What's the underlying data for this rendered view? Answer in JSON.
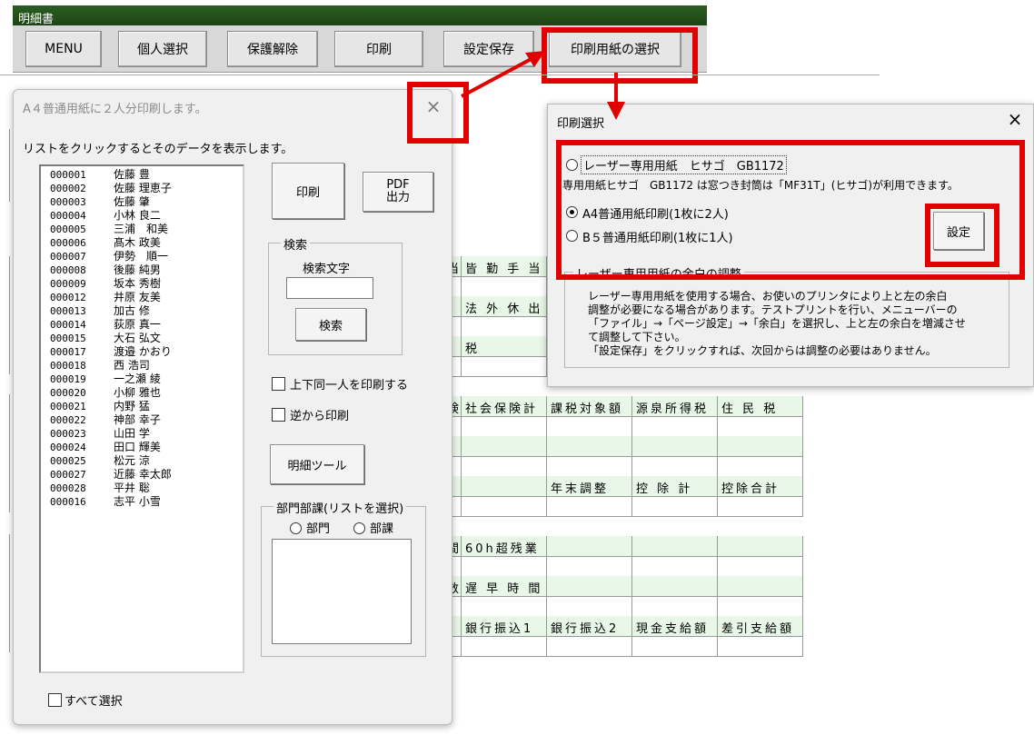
{
  "app": {
    "title": "明細書"
  },
  "toolbar": {
    "menu": "MENU",
    "individual": "個人選択",
    "unprotect": "保護解除",
    "print": "印刷",
    "save_settings": "設定保存",
    "paper_select": "印刷用紙の選択"
  },
  "sheet": {
    "rows": [
      [
        "当",
        "皆 勤 手 当",
        "",
        "",
        ""
      ],
      [
        "",
        "",
        "",
        "",
        ""
      ],
      [
        "",
        "法 外 休 出",
        "",
        "",
        ""
      ],
      [
        "",
        "",
        "",
        "",
        ""
      ],
      [
        "",
        "税",
        "",
        "",
        ""
      ],
      [
        "",
        "",
        "",
        "",
        ""
      ]
    ],
    "rows2": [
      [
        "険",
        "社会保険計",
        "課税対象額",
        "源泉所得税",
        "住 民 税"
      ],
      [
        "",
        "",
        "",
        "",
        ""
      ],
      [
        "",
        "",
        "",
        "",
        ""
      ],
      [
        "",
        "",
        "",
        "",
        ""
      ],
      [
        "",
        "",
        "年末調整",
        "控 除 計",
        "控除合計"
      ],
      [
        "",
        "",
        "",
        "",
        ""
      ]
    ],
    "rows3": [
      [
        "間",
        "60h超残業",
        "",
        "",
        ""
      ],
      [
        "",
        "",
        "",
        "",
        ""
      ],
      [
        "数",
        "遅 早 時 間",
        "",
        "",
        ""
      ],
      [
        "",
        "",
        "",
        "",
        ""
      ],
      [
        "",
        "銀行振込1",
        "銀行振込2",
        "現金支給額",
        "差引支給額"
      ],
      [
        "",
        "",
        "",
        "",
        ""
      ]
    ]
  },
  "dialog1": {
    "title": "A４普通用紙に２人分印刷します。",
    "close": "×",
    "instruction": "リストをクリックするとそのデータを表示します。",
    "employees": [
      {
        "id": "000001",
        "name": "佐藤 豊"
      },
      {
        "id": "000002",
        "name": "佐藤 理恵子"
      },
      {
        "id": "000003",
        "name": "佐藤 肇"
      },
      {
        "id": "000004",
        "name": "小林 良二"
      },
      {
        "id": "000005",
        "name": "三浦　和美"
      },
      {
        "id": "000006",
        "name": "髙木 政美"
      },
      {
        "id": "000007",
        "name": "伊勢　順一"
      },
      {
        "id": "000008",
        "name": "後藤 純男"
      },
      {
        "id": "000009",
        "name": "坂本 秀樹"
      },
      {
        "id": "000012",
        "name": "井原 友美"
      },
      {
        "id": "000013",
        "name": "加古 修"
      },
      {
        "id": "000014",
        "name": "荻原 真一"
      },
      {
        "id": "000015",
        "name": "大石 弘文"
      },
      {
        "id": "000017",
        "name": "渡邉 かおり"
      },
      {
        "id": "000018",
        "name": "西 浩司"
      },
      {
        "id": "000019",
        "name": "一之瀬 綾"
      },
      {
        "id": "000020",
        "name": "小柳 雅也"
      },
      {
        "id": "000021",
        "name": "内野 猛"
      },
      {
        "id": "000022",
        "name": "神部 幸子"
      },
      {
        "id": "000023",
        "name": "山田 学"
      },
      {
        "id": "000024",
        "name": "田口 輝美"
      },
      {
        "id": "000025",
        "name": "松元 涼"
      },
      {
        "id": "000027",
        "name": "近藤 幸太郎"
      },
      {
        "id": "000028",
        "name": "平井 聡"
      },
      {
        "id": "000016",
        "name": "志平 小雪"
      }
    ],
    "print_btn": "印刷",
    "pdf_line1": "PDF",
    "pdf_line2": "出力",
    "search_group": "検索",
    "search_label": "検索文字",
    "search_value": "",
    "search_btn": "検索",
    "same_person": "上下同一人を印刷する",
    "reverse_print": "逆から印刷",
    "tool_btn": "明細ツール",
    "dept_group": "部門部課(リストを選択)",
    "dept": "部門",
    "section": "部課",
    "select_all": "すべて選択"
  },
  "dialog2": {
    "title": "印刷選択",
    "close": "×",
    "opt_laser": "レーザー専用用紙　ヒサゴ　GB1172",
    "laser_note": "専用用紙ヒサゴ　GB1172 は窓つき封筒は「MF31T」(ヒサゴ)が利用できます。",
    "opt_a4": "A4普通用紙印刷(1枚に2人)",
    "opt_b5": "B５普通用紙印刷(1枚に1人)",
    "settings_btn": "設定",
    "margin_group": "レーザー専用用紙の余白の調整",
    "margin_text": [
      "レーザー専用用紙を使用する場合、お使いのプリンタにより上と左の余白",
      "調整が必要になる場合があります。テストプリントを行い、メニューバーの",
      "「ファイル」→「ページ設定」→「余白」を選択し、上と左の余白を増減させ",
      "て調整して下さい。",
      "「設定保存」をクリックすれば、次回からは調整の必要はありません。"
    ]
  },
  "colors": {
    "highlight_red": "#e00000",
    "title_green": "#1d4415",
    "cell_green": "#e8f7e8"
  }
}
